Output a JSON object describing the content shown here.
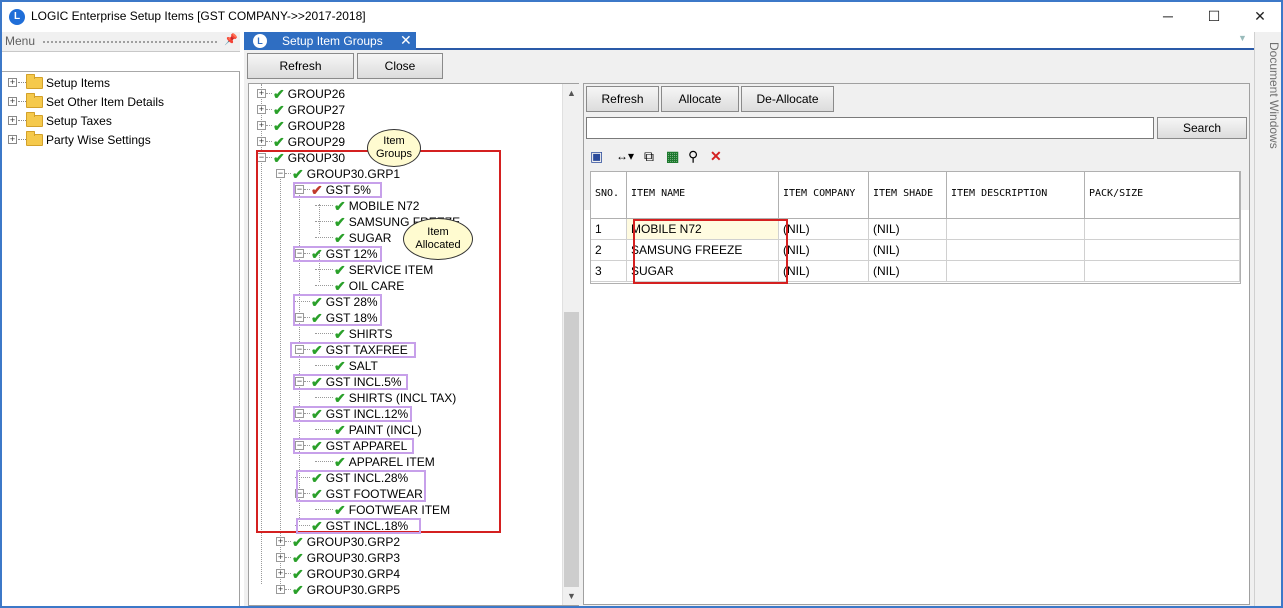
{
  "window": {
    "title": "LOGIC Enterprise Setup Items  [GST COMPANY->>2017-2018]",
    "minimize": "─",
    "maximize": "☐",
    "close": "✕"
  },
  "menu": {
    "title": "Menu",
    "pin": "ᵖ",
    "items": [
      {
        "label": "Setup Items"
      },
      {
        "label": "Set Other Item Details"
      },
      {
        "label": "Setup Taxes"
      },
      {
        "label": "Party Wise Settings"
      }
    ]
  },
  "tab": {
    "label": "Setup Item Groups",
    "close": "✕"
  },
  "side_panel": {
    "label": "Document Windows"
  },
  "top_toolbar": {
    "refresh": "Refresh",
    "close": "Close"
  },
  "tree": {
    "nodes": [
      {
        "label": "GROUP26"
      },
      {
        "label": "GROUP27"
      },
      {
        "label": "GROUP28"
      },
      {
        "label": "GROUP29"
      },
      {
        "label": "GROUP30"
      },
      {
        "label": "GROUP30.GRP1"
      },
      {
        "label": "GST 5%"
      },
      {
        "label": "MOBILE N72"
      },
      {
        "label": "SAMSUNG FREEZE"
      },
      {
        "label": "SUGAR"
      },
      {
        "label": "GST 12%"
      },
      {
        "label": "SERVICE ITEM"
      },
      {
        "label": "OIL CARE"
      },
      {
        "label": "GST 28%"
      },
      {
        "label": "GST 18%"
      },
      {
        "label": "SHIRTS"
      },
      {
        "label": "GST TAXFREE"
      },
      {
        "label": "SALT"
      },
      {
        "label": "GST INCL.5%"
      },
      {
        "label": "SHIRTS (INCL TAX)"
      },
      {
        "label": "GST INCL.12%"
      },
      {
        "label": "PAINT (INCL)"
      },
      {
        "label": "GST APPAREL"
      },
      {
        "label": "APPAREL ITEM"
      },
      {
        "label": "GST INCL.28%"
      },
      {
        "label": "GST FOOTWEAR"
      },
      {
        "label": "FOOTWEAR  ITEM"
      },
      {
        "label": "GST INCL.18%"
      },
      {
        "label": "GROUP30.GRP2"
      },
      {
        "label": "GROUP30.GRP3"
      },
      {
        "label": "GROUP30.GRP4"
      },
      {
        "label": "GROUP30.GRP5"
      }
    ]
  },
  "callouts": {
    "item_groups": "Item Groups",
    "item_allocated": "Item Allocated"
  },
  "grid_toolbar": {
    "refresh": "Refresh",
    "allocate": "Allocate",
    "deallocate": "De-Allocate",
    "search_value": "",
    "search": "Search"
  },
  "grid": {
    "columns": [
      "SNO.",
      "ITEM NAME",
      "ITEM COMPANY",
      "ITEM SHADE",
      "ITEM DESCRIPTION",
      "PACK/SIZE"
    ],
    "rows": [
      [
        "1",
        "MOBILE N72",
        "(NIL)",
        "(NIL)",
        "",
        ""
      ],
      [
        "2",
        "SAMSUNG FREEZE",
        "(NIL)",
        "(NIL)",
        "",
        ""
      ],
      [
        "3",
        "SUGAR",
        "(NIL)",
        "(NIL)",
        "",
        ""
      ]
    ]
  }
}
